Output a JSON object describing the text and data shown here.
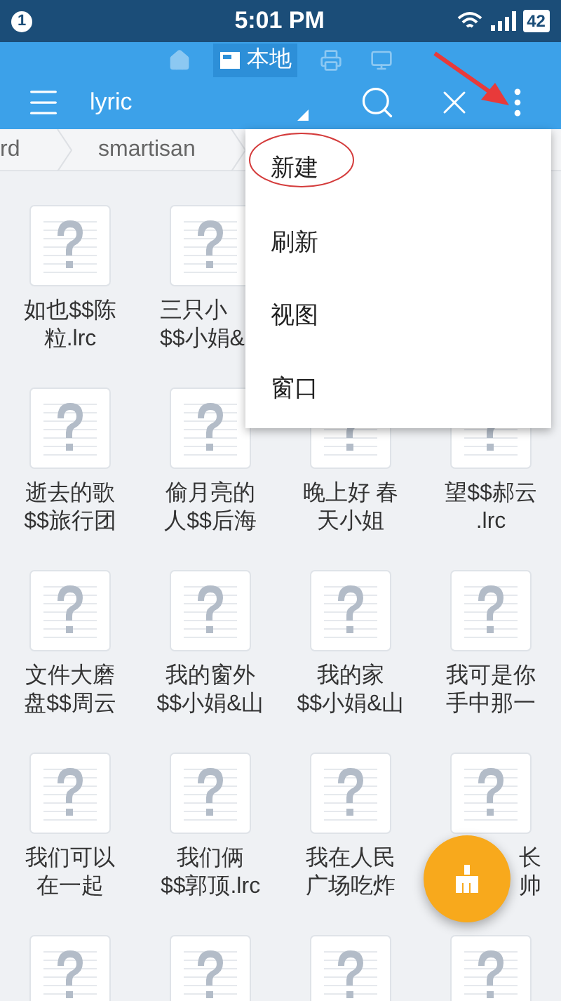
{
  "status_bar": {
    "notification_count": "1",
    "time": "5:01 PM",
    "battery": "42"
  },
  "location_tabs": [
    {
      "kind": "home",
      "selected": false
    },
    {
      "kind": "storage",
      "label": "本地",
      "selected": true
    },
    {
      "kind": "network",
      "selected": false
    },
    {
      "kind": "remote",
      "selected": false
    }
  ],
  "toolbar": {
    "title": "lyric"
  },
  "breadcrumbs": [
    "rd",
    "smartisan"
  ],
  "grid": [
    [
      {
        "kind": "file",
        "lines": [
          "如也$$陈",
          "粒.lrc"
        ]
      },
      {
        "kind": "file_cut_end",
        "lines": [
          "三只小",
          "$$小娟&"
        ]
      },
      {
        "kind": "hidden"
      },
      {
        "kind": "hidden"
      }
    ],
    [
      {
        "kind": "file",
        "lines": [
          "逝去的歌",
          "$$旅行团"
        ]
      },
      {
        "kind": "file",
        "lines": [
          "偷月亮的",
          "人$$后海"
        ]
      },
      {
        "kind": "file_under_menu",
        "lines": [
          "晚上好 春",
          "天小姐"
        ]
      },
      {
        "kind": "file_under_menu",
        "lines": [
          "望$$郝云",
          ".lrc"
        ]
      }
    ],
    [
      {
        "kind": "file",
        "lines": [
          "文件大磨",
          "盘$$周云"
        ]
      },
      {
        "kind": "file",
        "lines": [
          "我的窗外",
          "$$小娟&山"
        ]
      },
      {
        "kind": "file",
        "lines": [
          "我的家",
          "$$小娟&山"
        ]
      },
      {
        "kind": "file",
        "lines": [
          "我可是你",
          "手中那一"
        ]
      }
    ],
    [
      {
        "kind": "file",
        "lines": [
          "我们可以",
          "在一起"
        ]
      },
      {
        "kind": "file",
        "lines": [
          "我们俩",
          "$$郭顶.lrc"
        ]
      },
      {
        "kind": "file",
        "lines": [
          "我在人民",
          "广场吃炸"
        ]
      },
      {
        "kind": "file_cut_start",
        "lines": [
          "长",
          "帅"
        ]
      }
    ],
    [
      {
        "kind": "file_icon_only"
      },
      {
        "kind": "file_icon_only"
      },
      {
        "kind": "file_icon_only"
      },
      {
        "kind": "file_icon_only"
      }
    ]
  ],
  "menu": [
    {
      "label": "新建",
      "circled": true
    },
    {
      "label": "刷新",
      "circled": false
    },
    {
      "label": "视图",
      "circled": false
    },
    {
      "label": "窗口",
      "circled": false
    }
  ]
}
